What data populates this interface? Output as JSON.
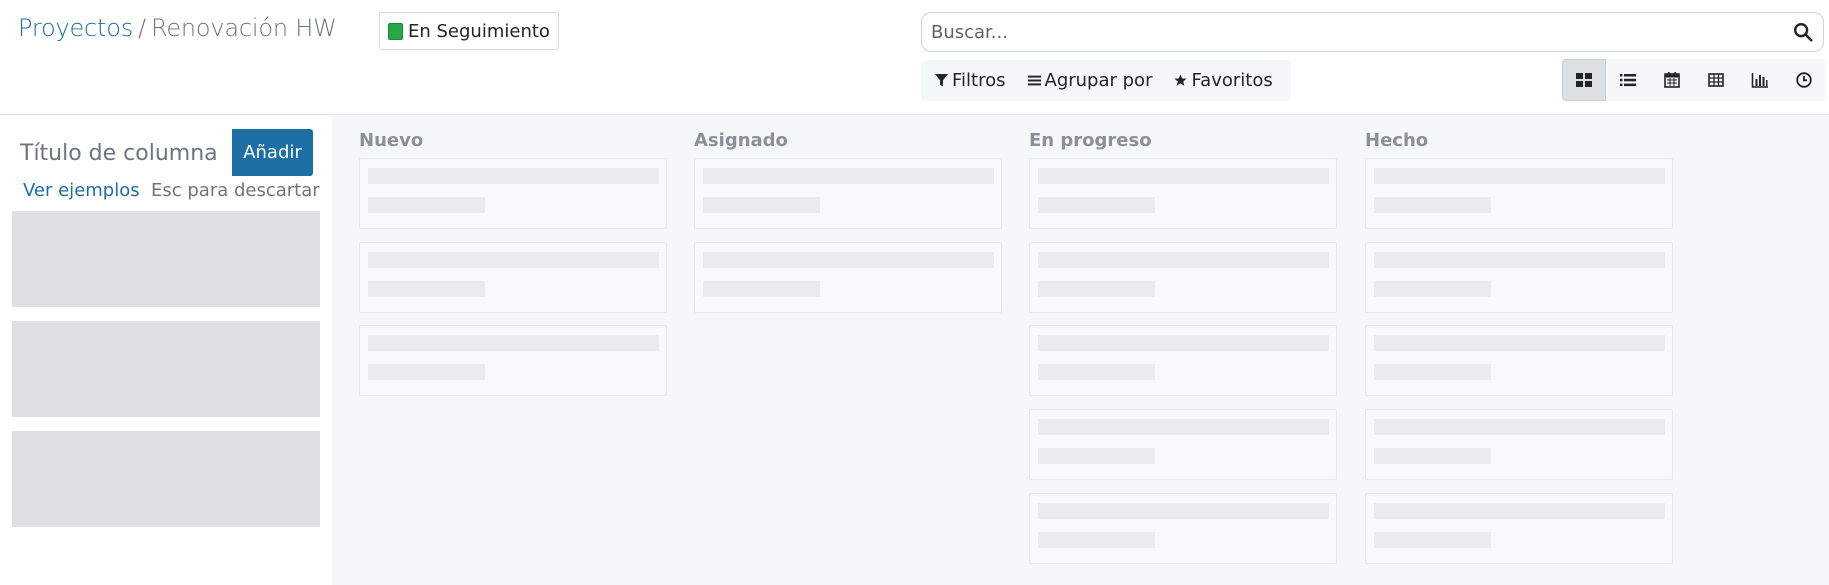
{
  "breadcrumb": {
    "parent": "Proyectos",
    "separator": "/",
    "current": "Renovación HW"
  },
  "status": {
    "label": "En Seguimiento",
    "color": "#28a745"
  },
  "search": {
    "placeholder": "Buscar...",
    "value": "",
    "icon": "search-icon"
  },
  "filters": {
    "filter_label": "Filtros",
    "group_label": "Agrupar por",
    "favorites_label": "Favoritos"
  },
  "views": [
    {
      "name": "kanban",
      "icon": "kanban-icon",
      "active": true
    },
    {
      "name": "list",
      "icon": "list-icon",
      "active": false
    },
    {
      "name": "calendar",
      "icon": "calendar-icon",
      "active": false
    },
    {
      "name": "pivot",
      "icon": "table-icon",
      "active": false
    },
    {
      "name": "graph",
      "icon": "bar-chart-icon",
      "active": false
    },
    {
      "name": "activity",
      "icon": "clock-icon",
      "active": false
    }
  ],
  "quick_create": {
    "placeholder": "Título de columna",
    "add_label": "Añadir",
    "examples_label": "Ver ejemplos",
    "esc_hint": "Esc para descartar"
  },
  "columns": [
    {
      "title": "Nuevo",
      "cards": 3
    },
    {
      "title": "Asignado",
      "cards": 2
    },
    {
      "title": "En progreso",
      "cards": 5
    },
    {
      "title": "Hecho",
      "cards": 5
    }
  ],
  "colors": {
    "accent": "#1c6ea4",
    "background": "#f6f7f9"
  }
}
